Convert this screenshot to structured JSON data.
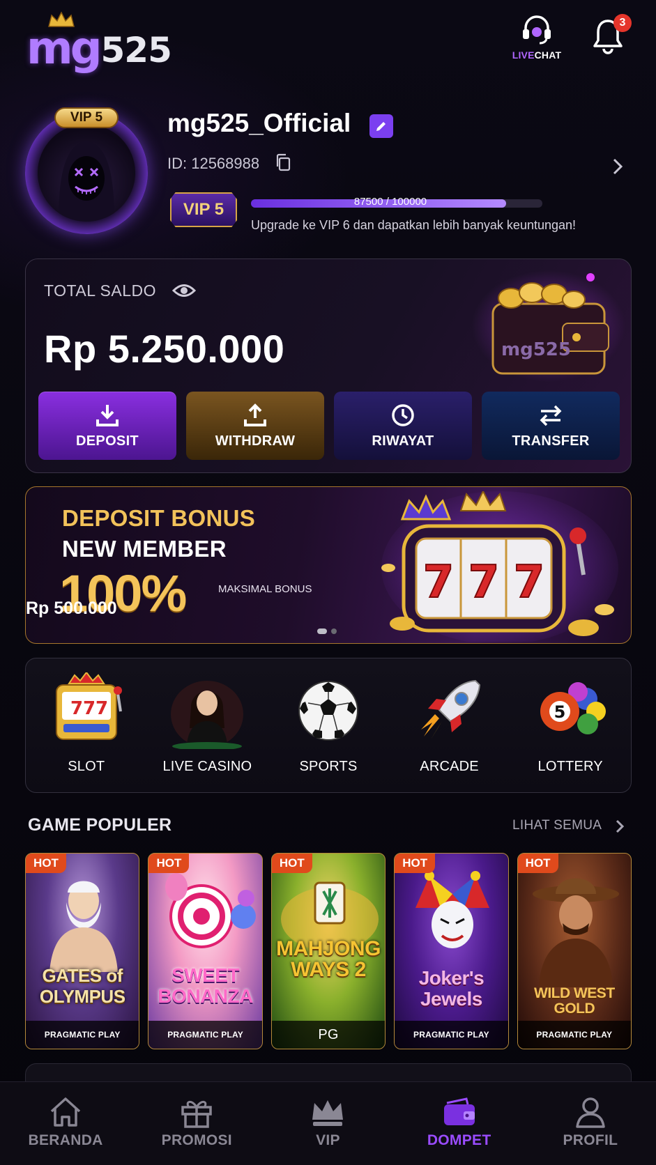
{
  "header": {
    "logo_text_main": "mg",
    "logo_text_num": "525",
    "livechat_live": "LIVE",
    "livechat_chat": "CHAT",
    "notification_count": "3",
    "icons": {
      "crown": "crown-icon",
      "livechat": "headset-icon",
      "bell": "bell-icon"
    }
  },
  "profile": {
    "vip_tag": "VIP 5",
    "username": "mg525_Official",
    "user_id": "ID: 12568988",
    "vip_badge": "VIP 5",
    "progress_text": "87500 / 100000",
    "progress_value": 87500,
    "progress_max": 100000,
    "upgrade_text": "Upgrade ke VIP 6 dan dapatkan lebih banyak keuntungan!"
  },
  "balance": {
    "label": "TOTAL SALDO",
    "amount": "Rp 5.250.000",
    "wallet_logo_text": "mg525",
    "actions": [
      {
        "label": "DEPOSIT",
        "icon": "download-icon"
      },
      {
        "label": "WITHDRAW",
        "icon": "upload-icon"
      },
      {
        "label": "RIWAYAT",
        "icon": "clock-icon"
      },
      {
        "label": "TRANSFER",
        "icon": "transfer-icon"
      }
    ]
  },
  "promo": {
    "line1": "DEPOSIT BONUS",
    "line2": "NEW MEMBER",
    "percent": "100%",
    "max_label": "MAKSIMAL BONUS",
    "max_value": "Rp 500.000",
    "slot_digits": [
      "7",
      "7",
      "7"
    ],
    "slide_count": 2,
    "active_slide": 0
  },
  "categories": [
    {
      "label": "SLOT",
      "icon": "slot-machine-icon"
    },
    {
      "label": "LIVE CASINO",
      "icon": "dealer-icon"
    },
    {
      "label": "SPORTS",
      "icon": "soccer-ball-icon"
    },
    {
      "label": "ARCADE",
      "icon": "rocket-icon"
    },
    {
      "label": "LOTTERY",
      "icon": "lottery-balls-icon",
      "ball_number": "5"
    }
  ],
  "popular": {
    "title": "GAME POPULER",
    "see_all": "LIHAT SEMUA",
    "games": [
      {
        "hot": "HOT",
        "title": "GATES of OLYMPUS",
        "provider": "PRAGMATIC PLAY"
      },
      {
        "hot": "HOT",
        "title": "SWEET BONANZA",
        "provider": "PRAGMATIC PLAY"
      },
      {
        "hot": "HOT",
        "title": "MAHJONG WAYS 2",
        "provider": "PG"
      },
      {
        "hot": "HOT",
        "title": "Joker's Jewels",
        "provider": "PRAGMATIC PLAY"
      },
      {
        "hot": "HOT",
        "title": "WILD WEST GOLD",
        "provider": "PRAGMATIC PLAY"
      }
    ]
  },
  "nav": {
    "items": [
      {
        "label": "BERANDA",
        "icon": "home-icon"
      },
      {
        "label": "PROMOSI",
        "icon": "gift-icon"
      },
      {
        "label": "VIP",
        "icon": "crown-icon"
      },
      {
        "label": "DOMPET",
        "icon": "wallet-icon",
        "active": true
      },
      {
        "label": "PROFIL",
        "icon": "user-icon"
      }
    ]
  },
  "colors": {
    "accent": "#9a4cff",
    "gold": "#f2c25a",
    "hot": "#e04a1c",
    "badge": "#e5352b"
  }
}
